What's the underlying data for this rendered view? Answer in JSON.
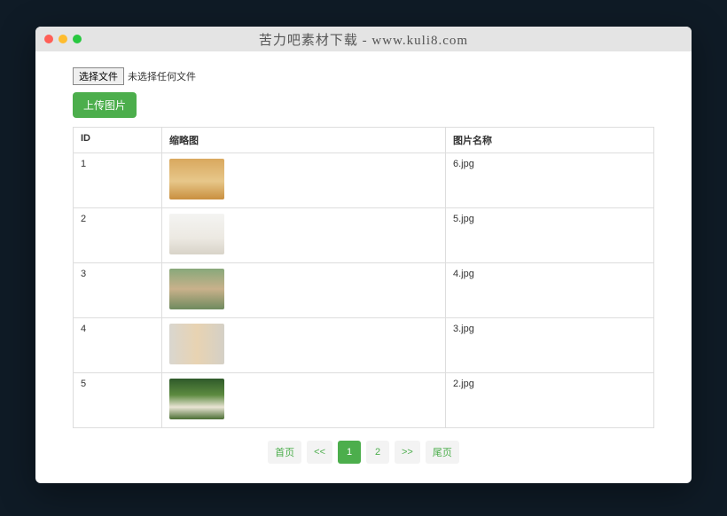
{
  "window": {
    "title": "苦力吧素材下载 - www.kuli8.com"
  },
  "file_input": {
    "choose_label": "选择文件",
    "status": "未选择任何文件"
  },
  "upload": {
    "label": "上传图片"
  },
  "table": {
    "headers": {
      "id": "ID",
      "thumb": "缩略图",
      "name": "图片名称"
    },
    "rows": [
      {
        "id": "1",
        "name": "6.jpg",
        "thumb_bg": "linear-gradient(180deg,#d9a85e 0%,#e7c78a 55%,#c98f3f 100%)"
      },
      {
        "id": "2",
        "name": "5.jpg",
        "thumb_bg": "linear-gradient(180deg,#f4f4f2 0%,#ece9e2 60%,#d8d3c8 100%)"
      },
      {
        "id": "3",
        "name": "4.jpg",
        "thumb_bg": "linear-gradient(180deg,#88a87a 0%,#c9b18b 50%,#6e8a5e 100%)"
      },
      {
        "id": "4",
        "name": "3.jpg",
        "thumb_bg": "linear-gradient(90deg,#d9d6cf 0%,#e8d3b2 50%,#d4d0c6 100%)"
      },
      {
        "id": "5",
        "name": "2.jpg",
        "thumb_bg": "linear-gradient(180deg,#2f5a2a 0%,#5c8a3f 40%,#e9e4d4 70%,#4a6e33 100%)"
      }
    ]
  },
  "pagination": {
    "first": "首页",
    "prev": "<<",
    "pages": [
      "1",
      "2"
    ],
    "current": "1",
    "next": ">>",
    "last": "尾页"
  }
}
